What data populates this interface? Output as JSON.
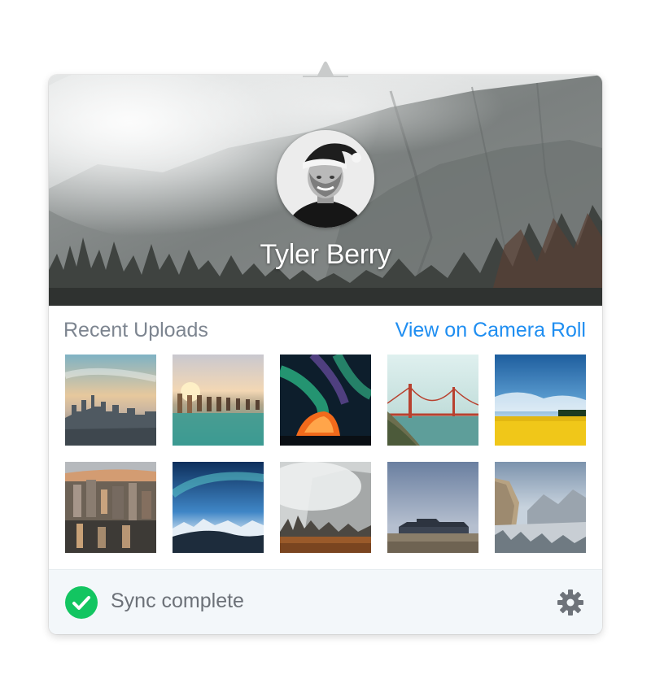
{
  "profile": {
    "name": "Tyler Berry"
  },
  "recent_uploads": {
    "title": "Recent Uploads",
    "link_label": "View on Camera Roll",
    "thumbnails": [
      {
        "subject": "city-skyline-sunset"
      },
      {
        "subject": "pier-posts-sunset"
      },
      {
        "subject": "aurora-tent"
      },
      {
        "subject": "golden-gate-bridge"
      },
      {
        "subject": "yellow-field-blue-sky"
      },
      {
        "subject": "city-aerial"
      },
      {
        "subject": "aurora-mountains"
      },
      {
        "subject": "foggy-valley"
      },
      {
        "subject": "lodge-twilight"
      },
      {
        "subject": "snowy-valley"
      }
    ]
  },
  "status": {
    "text": "Sync complete",
    "icon": "check-circle-icon",
    "color": "#13c561"
  },
  "settings": {
    "icon": "gear-icon"
  },
  "colors": {
    "link": "#1f8ef1",
    "footer_bg": "#f3f7fa"
  }
}
